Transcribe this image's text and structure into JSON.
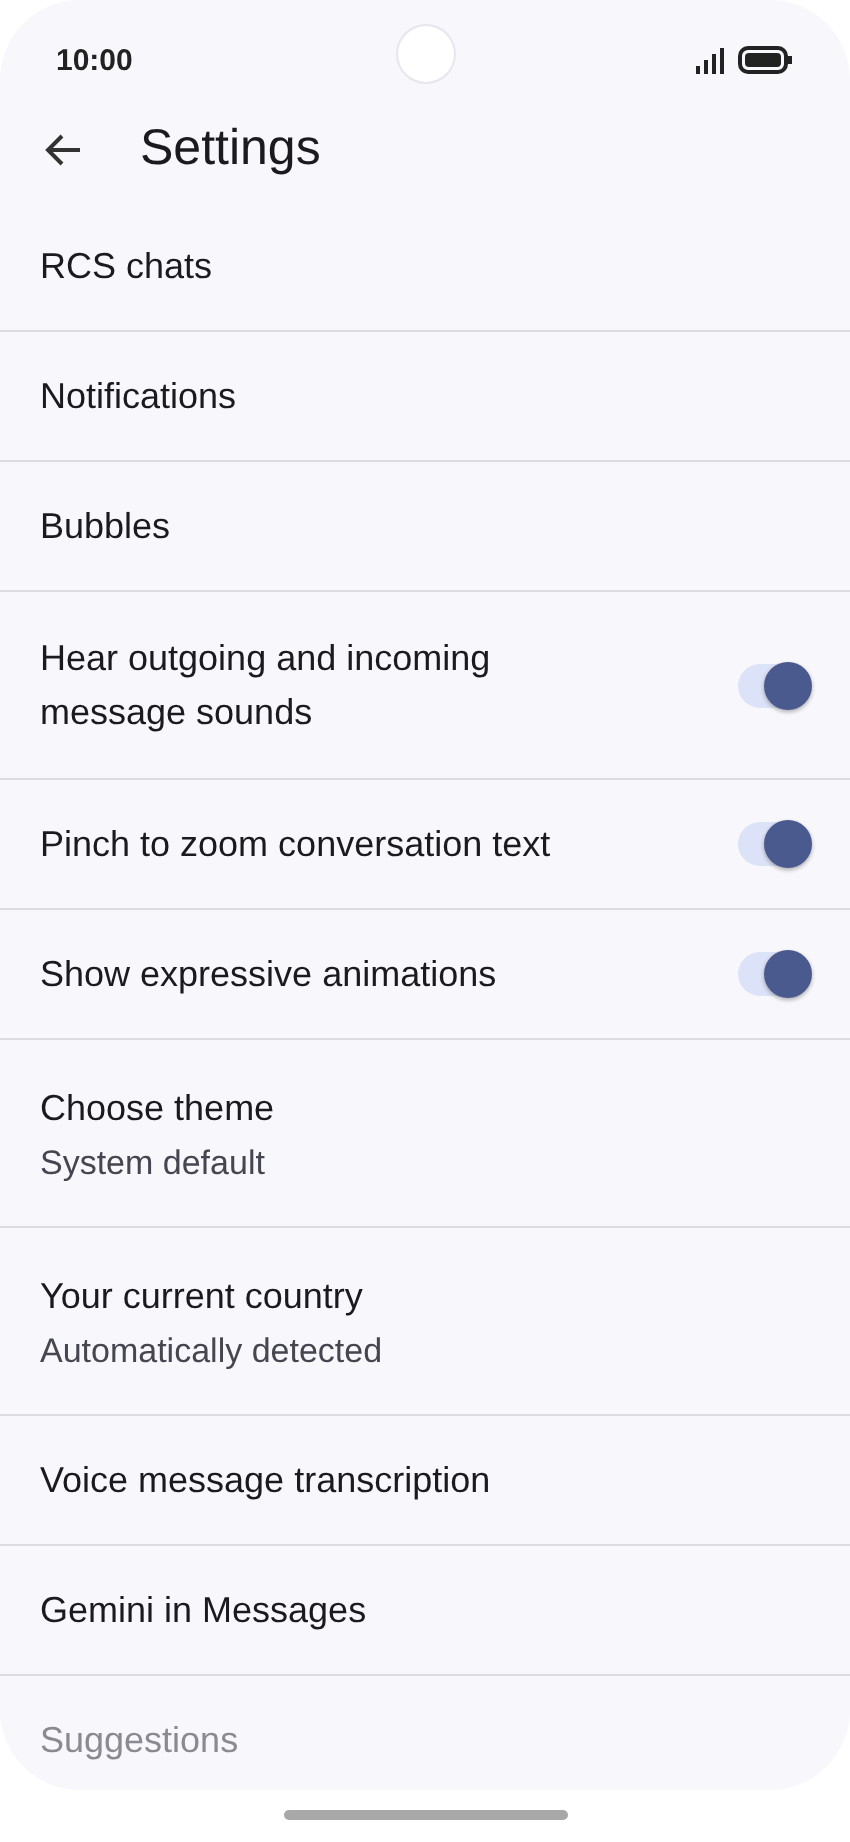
{
  "status_bar": {
    "time": "10:00"
  },
  "header": {
    "title": "Settings"
  },
  "settings": [
    {
      "kind": "link",
      "label": "RCS chats"
    },
    {
      "kind": "link",
      "label": "Notifications"
    },
    {
      "kind": "link",
      "label": "Bubbles"
    },
    {
      "kind": "toggle",
      "label": "Hear outgoing and incoming message sounds",
      "on": true
    },
    {
      "kind": "toggle",
      "label": "Pinch to zoom conversation text",
      "on": true
    },
    {
      "kind": "toggle",
      "label": "Show expressive animations",
      "on": true
    },
    {
      "kind": "value",
      "label": "Choose theme",
      "value": "System default"
    },
    {
      "kind": "value",
      "label": "Your current country",
      "value": "Automatically detected"
    },
    {
      "kind": "link",
      "label": "Voice message transcription"
    },
    {
      "kind": "link",
      "label": "Gemini in Messages"
    },
    {
      "kind": "faded",
      "label": "Suggestions"
    }
  ]
}
